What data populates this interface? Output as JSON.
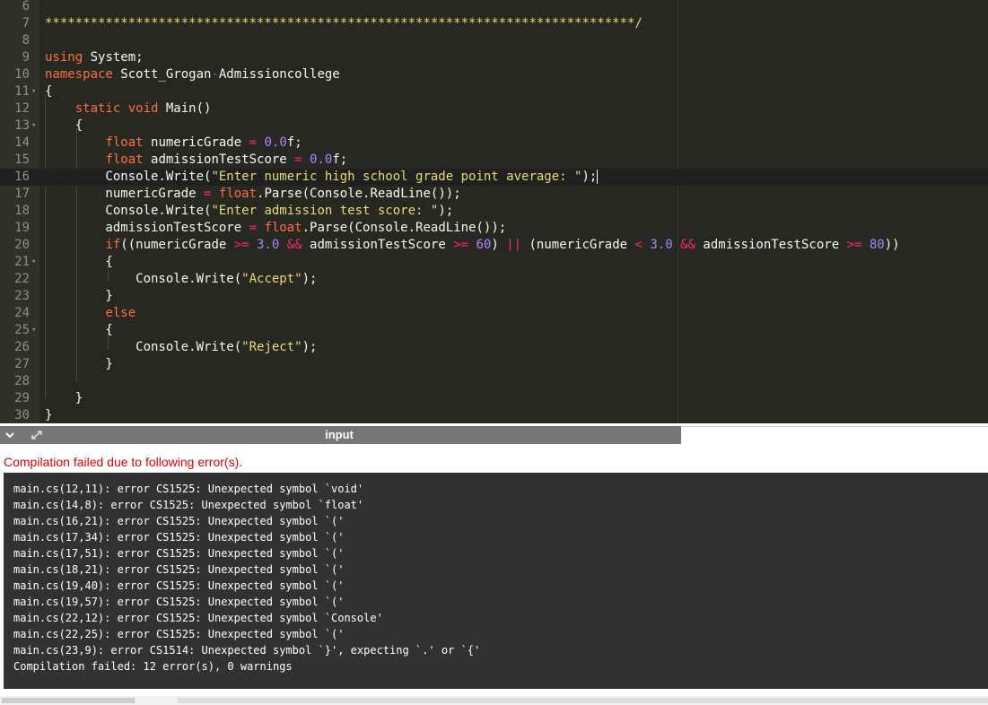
{
  "editor": {
    "lines": [
      {
        "n": "6",
        "fold": "",
        "segments": []
      },
      {
        "n": "7",
        "fold": "",
        "segments": [
          {
            "t": "com",
            "s": "******************************************************************************/"
          }
        ]
      },
      {
        "n": "8",
        "fold": "",
        "segments": []
      },
      {
        "n": "9",
        "fold": "",
        "segments": [
          {
            "t": "kwo",
            "s": "using"
          },
          {
            "t": "",
            "s": " System;"
          }
        ]
      },
      {
        "n": "10",
        "fold": "",
        "segments": [
          {
            "t": "kwo",
            "s": "namespace"
          },
          {
            "t": "",
            "s": " Scott_Grogan"
          },
          {
            "t": "op",
            "s": "-"
          },
          {
            "t": "",
            "s": "Admissioncollege"
          }
        ]
      },
      {
        "n": "11",
        "fold": "▾",
        "segments": [
          {
            "t": "",
            "s": "{"
          }
        ]
      },
      {
        "n": "12",
        "fold": "",
        "segments": [
          {
            "t": "",
            "s": "    "
          },
          {
            "t": "kwo",
            "s": "static"
          },
          {
            "t": "",
            "s": " "
          },
          {
            "t": "kwo",
            "s": "void"
          },
          {
            "t": "",
            "s": " Main()"
          }
        ]
      },
      {
        "n": "13",
        "fold": "▾",
        "segments": [
          {
            "t": "",
            "s": "    {"
          }
        ]
      },
      {
        "n": "14",
        "fold": "",
        "segments": [
          {
            "t": "",
            "s": "        "
          },
          {
            "t": "kwo",
            "s": "float"
          },
          {
            "t": "",
            "s": " numericGrade "
          },
          {
            "t": "op",
            "s": "="
          },
          {
            "t": "",
            "s": " "
          },
          {
            "t": "num",
            "s": "0.0"
          },
          {
            "t": "",
            "s": "f;"
          }
        ]
      },
      {
        "n": "15",
        "fold": "",
        "segments": [
          {
            "t": "",
            "s": "        "
          },
          {
            "t": "kwo",
            "s": "float"
          },
          {
            "t": "",
            "s": " admissionTestScore "
          },
          {
            "t": "op",
            "s": "="
          },
          {
            "t": "",
            "s": " "
          },
          {
            "t": "num",
            "s": "0.0"
          },
          {
            "t": "",
            "s": "f;"
          }
        ]
      },
      {
        "n": "16",
        "fold": "",
        "active": true,
        "segments": [
          {
            "t": "",
            "s": "        Console.Write("
          },
          {
            "t": "str",
            "s": "\"Enter numeric high school grade point average: \""
          },
          {
            "t": "",
            "s": ");"
          }
        ]
      },
      {
        "n": "17",
        "fold": "",
        "segments": [
          {
            "t": "",
            "s": "        numericGrade "
          },
          {
            "t": "op",
            "s": "="
          },
          {
            "t": "",
            "s": " "
          },
          {
            "t": "kwo",
            "s": "float"
          },
          {
            "t": "",
            "s": ".Parse(Console.ReadLine());"
          }
        ]
      },
      {
        "n": "18",
        "fold": "",
        "segments": [
          {
            "t": "",
            "s": "        Console.Write("
          },
          {
            "t": "str",
            "s": "\"Enter admission test score: \""
          },
          {
            "t": "",
            "s": ");"
          }
        ]
      },
      {
        "n": "19",
        "fold": "",
        "segments": [
          {
            "t": "",
            "s": "        admissionTestScore "
          },
          {
            "t": "op",
            "s": "="
          },
          {
            "t": "",
            "s": " "
          },
          {
            "t": "kwo",
            "s": "float"
          },
          {
            "t": "",
            "s": ".Parse(Console.ReadLine());"
          }
        ]
      },
      {
        "n": "20",
        "fold": "",
        "segments": [
          {
            "t": "",
            "s": "        "
          },
          {
            "t": "kwo",
            "s": "if"
          },
          {
            "t": "",
            "s": "((numericGrade "
          },
          {
            "t": "op",
            "s": ">="
          },
          {
            "t": "",
            "s": " "
          },
          {
            "t": "num",
            "s": "3.0"
          },
          {
            "t": "",
            "s": " "
          },
          {
            "t": "op",
            "s": "&&"
          },
          {
            "t": "",
            "s": " admissionTestScore "
          },
          {
            "t": "op",
            "s": ">="
          },
          {
            "t": "",
            "s": " "
          },
          {
            "t": "num",
            "s": "60"
          },
          {
            "t": "",
            "s": ") "
          },
          {
            "t": "op",
            "s": "||"
          },
          {
            "t": "",
            "s": " (numericGrade "
          },
          {
            "t": "op",
            "s": "<"
          },
          {
            "t": "",
            "s": " "
          },
          {
            "t": "num",
            "s": "3.0"
          },
          {
            "t": "",
            "s": " "
          },
          {
            "t": "op",
            "s": "&&"
          },
          {
            "t": "",
            "s": " admissionTestScore "
          },
          {
            "t": "op",
            "s": ">="
          },
          {
            "t": "",
            "s": " "
          },
          {
            "t": "num",
            "s": "80"
          },
          {
            "t": "",
            "s": "))"
          }
        ]
      },
      {
        "n": "21",
        "fold": "▾",
        "segments": [
          {
            "t": "",
            "s": "        {"
          }
        ]
      },
      {
        "n": "22",
        "fold": "",
        "segments": [
          {
            "t": "",
            "s": "            Console.Write("
          },
          {
            "t": "str",
            "s": "\"Accept\""
          },
          {
            "t": "",
            "s": ");"
          }
        ]
      },
      {
        "n": "23",
        "fold": "",
        "segments": [
          {
            "t": "",
            "s": "        }"
          }
        ]
      },
      {
        "n": "24",
        "fold": "",
        "segments": [
          {
            "t": "",
            "s": "        "
          },
          {
            "t": "kwo",
            "s": "else"
          }
        ]
      },
      {
        "n": "25",
        "fold": "▾",
        "segments": [
          {
            "t": "",
            "s": "        {"
          }
        ]
      },
      {
        "n": "26",
        "fold": "",
        "segments": [
          {
            "t": "",
            "s": "            Console.Write("
          },
          {
            "t": "str",
            "s": "\"Reject\""
          },
          {
            "t": "",
            "s": ");"
          }
        ]
      },
      {
        "n": "27",
        "fold": "",
        "segments": [
          {
            "t": "",
            "s": "        }"
          }
        ]
      },
      {
        "n": "28",
        "fold": "",
        "segments": []
      },
      {
        "n": "29",
        "fold": "",
        "segments": [
          {
            "t": "",
            "s": "    }"
          }
        ]
      },
      {
        "n": "30",
        "fold": "",
        "segments": [
          {
            "t": "",
            "s": "}"
          }
        ]
      }
    ]
  },
  "io_panel": {
    "title": "input",
    "collapse_icon": "chevron-down-icon",
    "expand_icon": "expand-icon"
  },
  "output": {
    "error_heading": "Compilation failed due to following error(s).",
    "lines": [
      "main.cs(12,11): error CS1525: Unexpected symbol `void'",
      "main.cs(14,8): error CS1525: Unexpected symbol `float'",
      "main.cs(16,21): error CS1525: Unexpected symbol `('",
      "main.cs(17,34): error CS1525: Unexpected symbol `('",
      "main.cs(17,51): error CS1525: Unexpected symbol `('",
      "main.cs(18,21): error CS1525: Unexpected symbol `('",
      "main.cs(19,40): error CS1525: Unexpected symbol `('",
      "main.cs(19,57): error CS1525: Unexpected symbol `('",
      "main.cs(22,12): error CS1525: Unexpected symbol `Console'",
      "main.cs(22,25): error CS1525: Unexpected symbol `('",
      "main.cs(23,9): error CS1514: Unexpected symbol `}', expecting `.' or `{'",
      "Compilation failed: 12 error(s), 0 warnings"
    ]
  },
  "colors": {
    "editor_bg": "#272822",
    "keyword": "#ff6e40",
    "string": "#e6db74",
    "number": "#ae81ff",
    "error_text": "#e00000",
    "output_bg": "#323232"
  }
}
